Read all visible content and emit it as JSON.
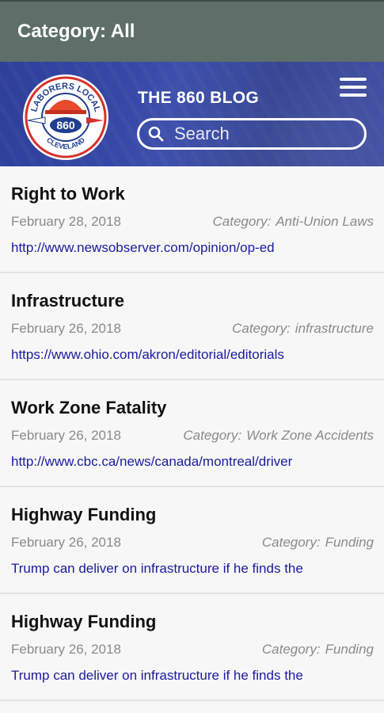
{
  "topbar": {
    "title": "Category: All"
  },
  "header": {
    "blog_title": "THE 860 BLOG",
    "search_placeholder": "Search",
    "logo": {
      "top_text": "LABORERS LOCAL",
      "number": "860",
      "bottom_text": "CLEVELAND"
    }
  },
  "posts": [
    {
      "title": "Right to Work",
      "date": "February 28, 2018",
      "category_label": "Category:",
      "category": "Anti-Union Laws",
      "link": "http://www.newsobserver.com/opinion/op-ed"
    },
    {
      "title": "Infrastructure",
      "date": "February 26, 2018",
      "category_label": "Category:",
      "category": "infrastructure",
      "link": "https://www.ohio.com/akron/editorial/editorials"
    },
    {
      "title": "Work Zone Fatality",
      "date": "February 26, 2018",
      "category_label": "Category:",
      "category": "Work Zone Accidents",
      "link": "http://www.cbc.ca/news/canada/montreal/driver"
    },
    {
      "title": "Highway Funding",
      "date": "February 26, 2018",
      "category_label": "Category:",
      "category": "Funding",
      "link": "Trump can deliver on infrastructure if he finds the"
    },
    {
      "title": "Highway Funding",
      "date": "February 26, 2018",
      "category_label": "Category:",
      "category": "Funding",
      "link": "Trump can deliver on infrastructure if he finds the"
    }
  ],
  "colors": {
    "topbar": "#5d6f68",
    "header": "#2e3f9a",
    "link": "#1b1b9e",
    "meta_text": "#8a8a8a"
  }
}
